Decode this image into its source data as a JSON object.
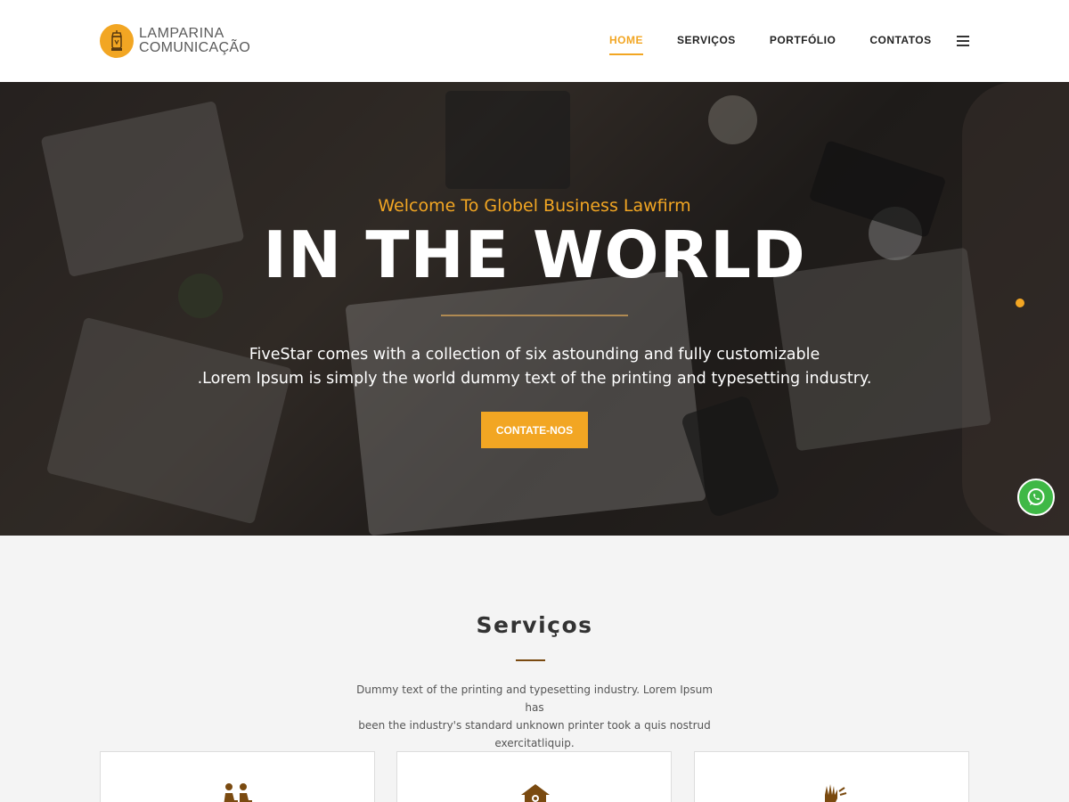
{
  "header": {
    "logo": {
      "line1": "LAMPARINA",
      "line2": "COMUNICAÇÃO",
      "icon": "lamp-icon"
    },
    "nav": [
      {
        "label": "HOME",
        "active": true
      },
      {
        "label": "SERVIÇOS",
        "active": false
      },
      {
        "label": "PORTFÓLIO",
        "active": false
      },
      {
        "label": "CONTATOS",
        "active": false
      }
    ],
    "menu_icon": "hamburger-menu-icon"
  },
  "hero": {
    "subtitle": "Welcome To Globel Business Lawfirm",
    "title": "IN THE WORLD",
    "text_line1": "FiveStar comes with a collection of six astounding and fully customizable",
    "text_line2": ".Lorem Ipsum is simply the world dummy text of the printing and typesetting industry.",
    "cta_label": "CONTATE-NOS"
  },
  "floating": {
    "whatsapp_icon": "whatsapp-icon"
  },
  "services": {
    "title": "Serviços",
    "text_line1": "Dummy text of the printing and typesetting industry. Lorem Ipsum has",
    "text_line2": "been the industry's standard unknown printer took a quis nostrud",
    "text_line3": "exercitatliquip.",
    "cards": [
      {
        "icon": "people-meeting-icon"
      },
      {
        "icon": "house-icon"
      },
      {
        "icon": "hand-icon"
      }
    ]
  },
  "colors": {
    "accent": "#f2a623",
    "brown": "#7a4a10",
    "whatsapp": "#3fb846"
  }
}
